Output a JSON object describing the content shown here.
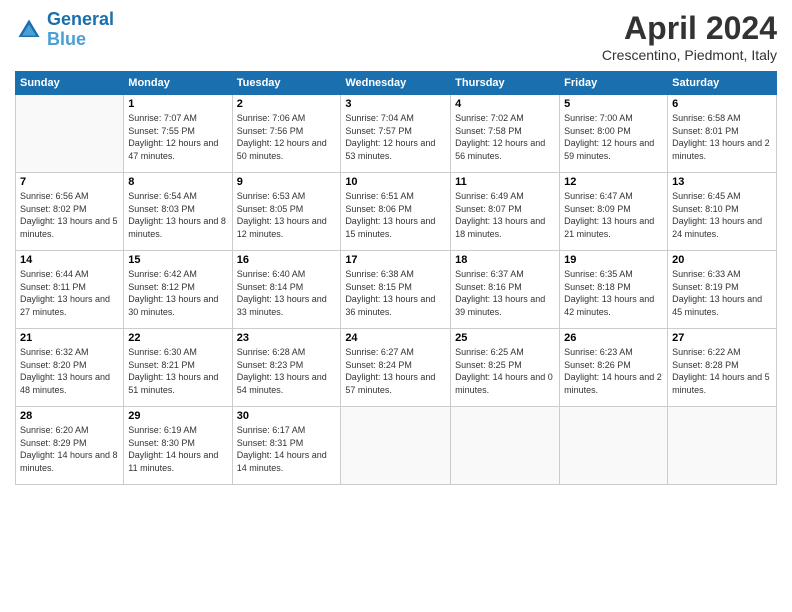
{
  "header": {
    "logo_line1": "General",
    "logo_line2": "Blue",
    "month_title": "April 2024",
    "location": "Crescentino, Piedmont, Italy"
  },
  "days_of_week": [
    "Sunday",
    "Monday",
    "Tuesday",
    "Wednesday",
    "Thursday",
    "Friday",
    "Saturday"
  ],
  "weeks": [
    [
      {
        "day": "",
        "empty": true
      },
      {
        "day": "1",
        "sunrise": "7:07 AM",
        "sunset": "7:55 PM",
        "daylight": "12 hours and 47 minutes."
      },
      {
        "day": "2",
        "sunrise": "7:06 AM",
        "sunset": "7:56 PM",
        "daylight": "12 hours and 50 minutes."
      },
      {
        "day": "3",
        "sunrise": "7:04 AM",
        "sunset": "7:57 PM",
        "daylight": "12 hours and 53 minutes."
      },
      {
        "day": "4",
        "sunrise": "7:02 AM",
        "sunset": "7:58 PM",
        "daylight": "12 hours and 56 minutes."
      },
      {
        "day": "5",
        "sunrise": "7:00 AM",
        "sunset": "8:00 PM",
        "daylight": "12 hours and 59 minutes."
      },
      {
        "day": "6",
        "sunrise": "6:58 AM",
        "sunset": "8:01 PM",
        "daylight": "13 hours and 2 minutes."
      }
    ],
    [
      {
        "day": "7",
        "sunrise": "6:56 AM",
        "sunset": "8:02 PM",
        "daylight": "13 hours and 5 minutes."
      },
      {
        "day": "8",
        "sunrise": "6:54 AM",
        "sunset": "8:03 PM",
        "daylight": "13 hours and 8 minutes."
      },
      {
        "day": "9",
        "sunrise": "6:53 AM",
        "sunset": "8:05 PM",
        "daylight": "13 hours and 12 minutes."
      },
      {
        "day": "10",
        "sunrise": "6:51 AM",
        "sunset": "8:06 PM",
        "daylight": "13 hours and 15 minutes."
      },
      {
        "day": "11",
        "sunrise": "6:49 AM",
        "sunset": "8:07 PM",
        "daylight": "13 hours and 18 minutes."
      },
      {
        "day": "12",
        "sunrise": "6:47 AM",
        "sunset": "8:09 PM",
        "daylight": "13 hours and 21 minutes."
      },
      {
        "day": "13",
        "sunrise": "6:45 AM",
        "sunset": "8:10 PM",
        "daylight": "13 hours and 24 minutes."
      }
    ],
    [
      {
        "day": "14",
        "sunrise": "6:44 AM",
        "sunset": "8:11 PM",
        "daylight": "13 hours and 27 minutes."
      },
      {
        "day": "15",
        "sunrise": "6:42 AM",
        "sunset": "8:12 PM",
        "daylight": "13 hours and 30 minutes."
      },
      {
        "day": "16",
        "sunrise": "6:40 AM",
        "sunset": "8:14 PM",
        "daylight": "13 hours and 33 minutes."
      },
      {
        "day": "17",
        "sunrise": "6:38 AM",
        "sunset": "8:15 PM",
        "daylight": "13 hours and 36 minutes."
      },
      {
        "day": "18",
        "sunrise": "6:37 AM",
        "sunset": "8:16 PM",
        "daylight": "13 hours and 39 minutes."
      },
      {
        "day": "19",
        "sunrise": "6:35 AM",
        "sunset": "8:18 PM",
        "daylight": "13 hours and 42 minutes."
      },
      {
        "day": "20",
        "sunrise": "6:33 AM",
        "sunset": "8:19 PM",
        "daylight": "13 hours and 45 minutes."
      }
    ],
    [
      {
        "day": "21",
        "sunrise": "6:32 AM",
        "sunset": "8:20 PM",
        "daylight": "13 hours and 48 minutes."
      },
      {
        "day": "22",
        "sunrise": "6:30 AM",
        "sunset": "8:21 PM",
        "daylight": "13 hours and 51 minutes."
      },
      {
        "day": "23",
        "sunrise": "6:28 AM",
        "sunset": "8:23 PM",
        "daylight": "13 hours and 54 minutes."
      },
      {
        "day": "24",
        "sunrise": "6:27 AM",
        "sunset": "8:24 PM",
        "daylight": "13 hours and 57 minutes."
      },
      {
        "day": "25",
        "sunrise": "6:25 AM",
        "sunset": "8:25 PM",
        "daylight": "14 hours and 0 minutes."
      },
      {
        "day": "26",
        "sunrise": "6:23 AM",
        "sunset": "8:26 PM",
        "daylight": "14 hours and 2 minutes."
      },
      {
        "day": "27",
        "sunrise": "6:22 AM",
        "sunset": "8:28 PM",
        "daylight": "14 hours and 5 minutes."
      }
    ],
    [
      {
        "day": "28",
        "sunrise": "6:20 AM",
        "sunset": "8:29 PM",
        "daylight": "14 hours and 8 minutes."
      },
      {
        "day": "29",
        "sunrise": "6:19 AM",
        "sunset": "8:30 PM",
        "daylight": "14 hours and 11 minutes."
      },
      {
        "day": "30",
        "sunrise": "6:17 AM",
        "sunset": "8:31 PM",
        "daylight": "14 hours and 14 minutes."
      },
      {
        "day": "",
        "empty": true
      },
      {
        "day": "",
        "empty": true
      },
      {
        "day": "",
        "empty": true
      },
      {
        "day": "",
        "empty": true
      }
    ]
  ]
}
